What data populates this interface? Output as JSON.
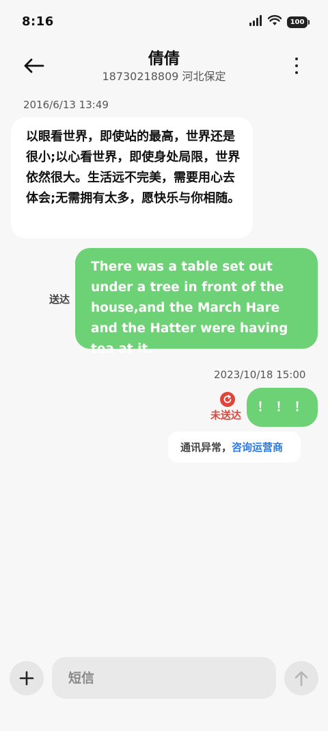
{
  "status_bar": {
    "time": "8:16",
    "battery": "100",
    "icons": [
      "signal-icon",
      "wifi-icon",
      "battery-icon"
    ]
  },
  "header": {
    "contact_name": "倩倩",
    "contact_sub": "18730218809 河北保定",
    "icons": [
      "back-arrow-icon",
      "more-vertical-icon"
    ]
  },
  "messages": {
    "timestamp1": "2016/6/13 13:49",
    "incoming_text": "以眼看世界，即使站的最高，世界还是很小;以心看世界，即使身处局限，世界依然很大。生活远不完美，需要用心去体会;无需拥有太多，愿快乐与你相随。",
    "outgoing_text": "There was a table set out under a tree in front of the house,and the March Hare and the Hatter were having tea at it.",
    "delivered_label": "送达",
    "timestamp2": "2023/10/18 15:00",
    "outgoing_text2": "！！！",
    "failed_label": "未送达",
    "notice_text": "通讯异常，",
    "notice_link": "咨询运营商"
  },
  "input_bar": {
    "placeholder": "短信",
    "icons": [
      "plus-icon",
      "send-arrow-icon"
    ]
  },
  "colors": {
    "outgoing_bubble": "#6dd176",
    "error_red": "#e0453a",
    "link_blue": "#2a7ae2",
    "background": "#f7f7f7"
  }
}
